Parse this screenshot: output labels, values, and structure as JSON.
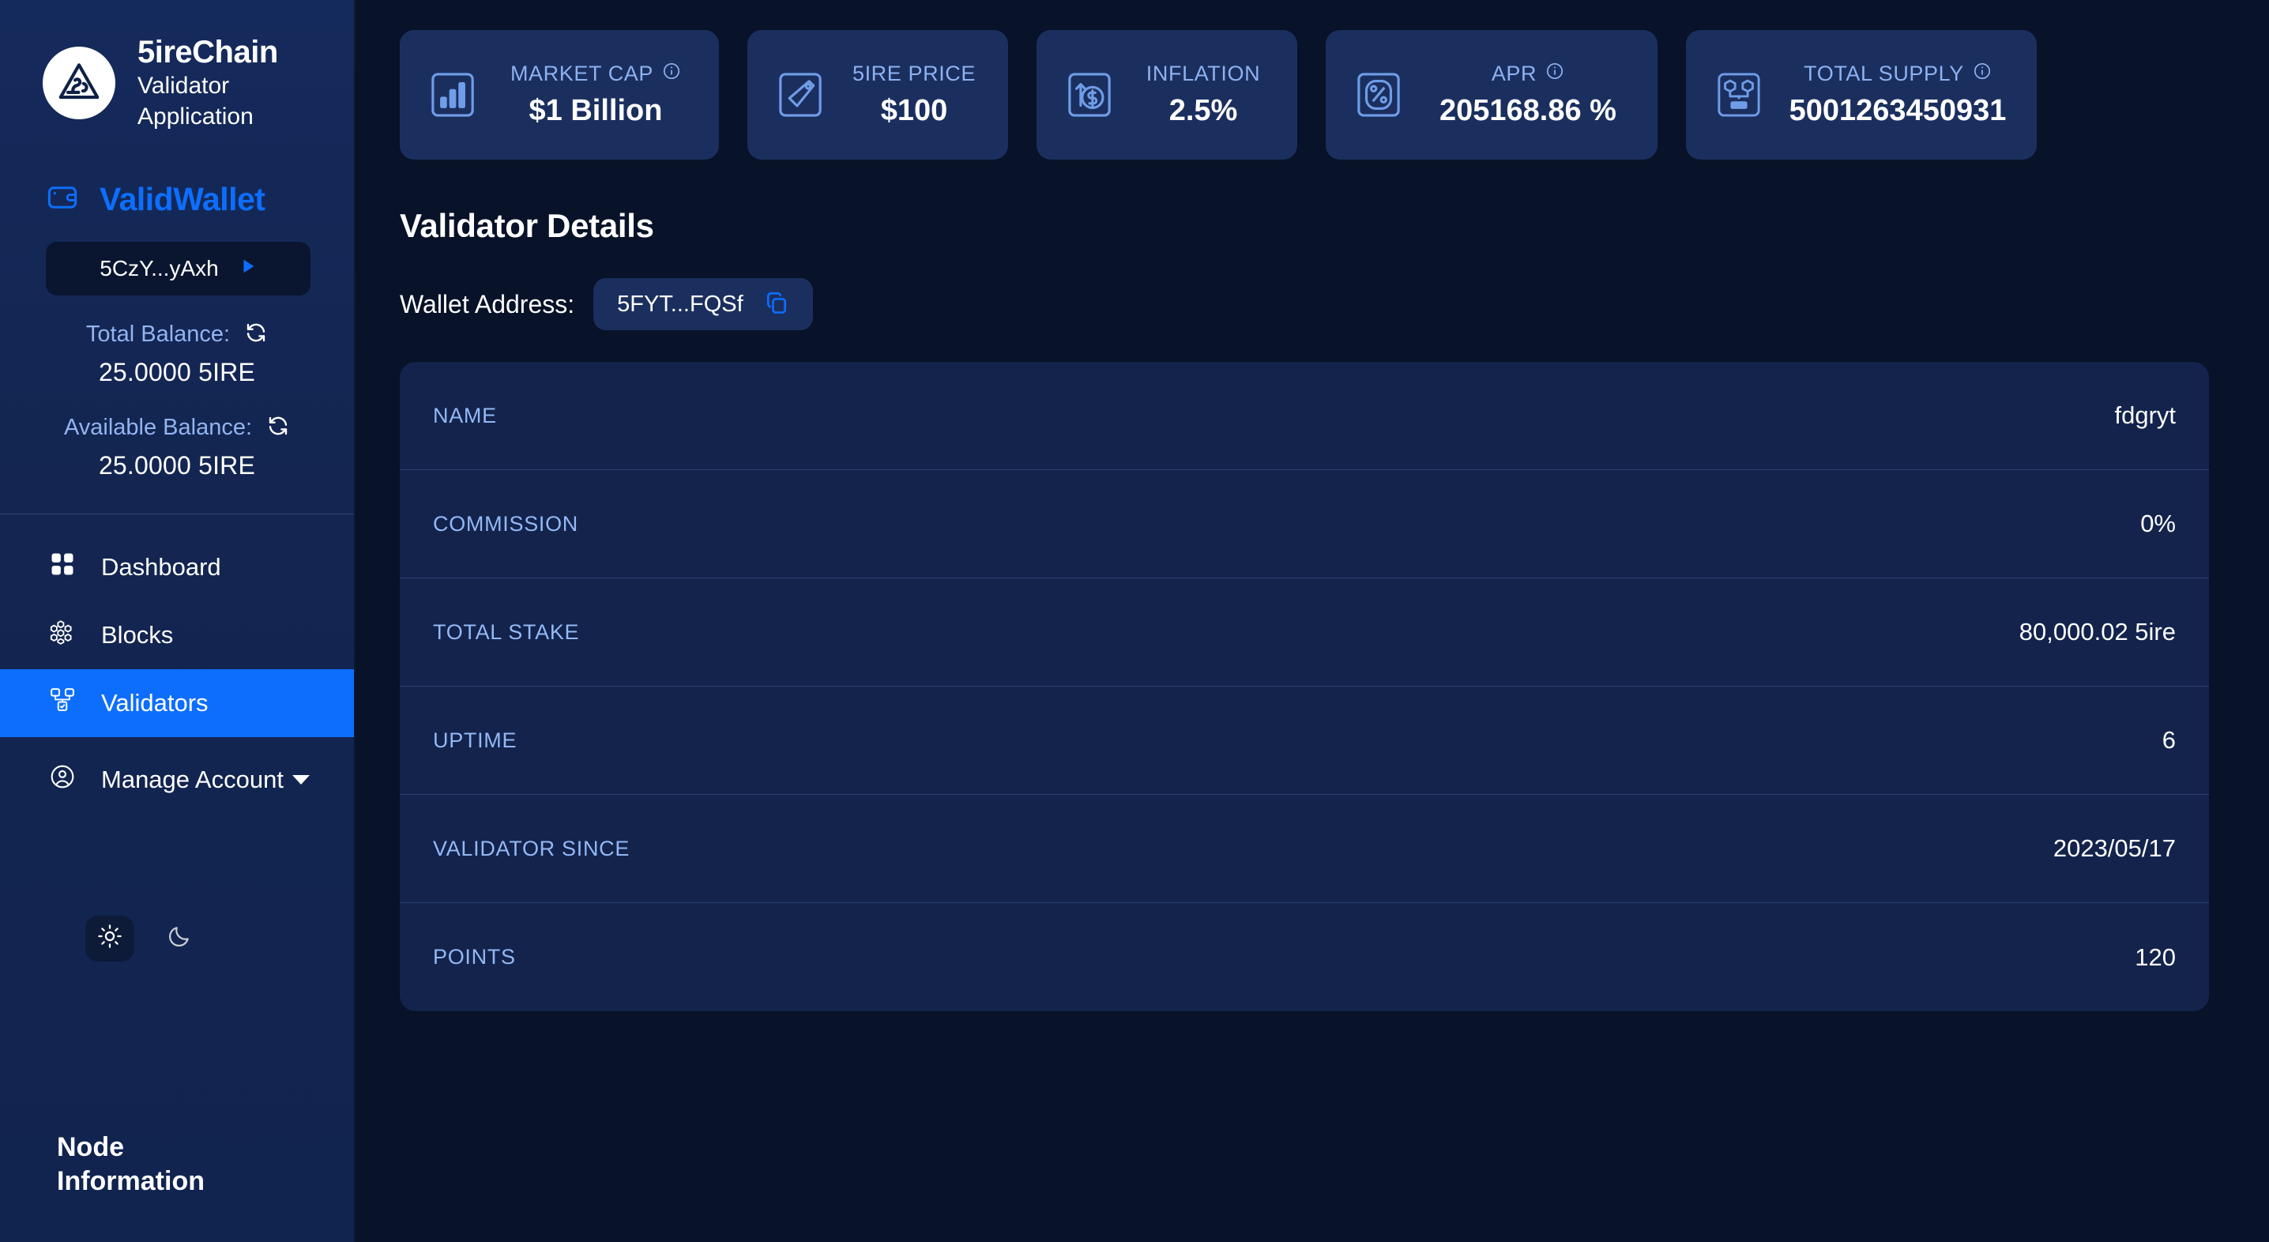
{
  "sidebar": {
    "brand": {
      "logo_icon": "5irechain-triangle-logo",
      "title": "5ireChain",
      "subtitle": "Validator Application"
    },
    "wallet": {
      "icon": "wallet-icon",
      "name": "ValidWallet",
      "address_short": "5CzY...yAxh",
      "expand_icon": "play-triangle-icon"
    },
    "balances": [
      {
        "label": "Total Balance:",
        "refresh_icon": "refresh-icon",
        "value": "25.0000 5IRE"
      },
      {
        "label": "Available Balance:",
        "refresh_icon": "refresh-icon",
        "value": "25.0000 5IRE"
      }
    ],
    "nav": [
      {
        "label": "Dashboard",
        "icon": "grid-dashboard-icon",
        "active": false
      },
      {
        "label": "Blocks",
        "icon": "blocks-network-icon",
        "active": false
      },
      {
        "label": "Validators",
        "icon": "validator-node-icon",
        "active": true
      },
      {
        "label": "Manage Account",
        "icon": "user-circle-icon",
        "active": false,
        "caret": "chevron-down-icon"
      }
    ],
    "theme": {
      "light_icon": "sun-icon",
      "dark_icon": "moon-icon",
      "selected": "light"
    },
    "footer": {
      "label": "Node Information"
    }
  },
  "stats": [
    {
      "label": "MARKET CAP",
      "value": "$1 Billion",
      "icon": "bar-chart-icon",
      "info": true
    },
    {
      "label": "5IRE PRICE",
      "value": "$100",
      "icon": "price-tag-icon",
      "info": false
    },
    {
      "label": "INFLATION",
      "value": "2.5%",
      "icon": "inflation-arrow-dollar-icon",
      "info": false
    },
    {
      "label": "APR",
      "value": "205168.86 %",
      "icon": "percent-icon",
      "info": true
    },
    {
      "label": "TOTAL SUPPLY",
      "value": "5001263450931",
      "icon": "supply-cubes-icon",
      "info": true
    }
  ],
  "main": {
    "page_title": "Validator Details",
    "wallet_address_label": "Wallet Address:",
    "wallet_address_value": "5FYT...FQSf",
    "copy_icon": "copy-icon",
    "details": [
      {
        "key": "NAME",
        "value": "fdgryt"
      },
      {
        "key": "COMMISSION",
        "value": "0%"
      },
      {
        "key": "TOTAL STAKE",
        "value": "80,000.02  5ire"
      },
      {
        "key": "UPTIME",
        "value": "6"
      },
      {
        "key": "VALIDATOR SINCE",
        "value": "2023/05/17"
      },
      {
        "key": "POINTS",
        "value": "120"
      }
    ]
  },
  "colors": {
    "accent": "#0d6efd",
    "sidebar_bg": "#14264f",
    "main_bg": "#081228",
    "card_bg": "#1b2f5f",
    "detail_bg": "#13234c",
    "label_blue": "#93b8f5"
  }
}
